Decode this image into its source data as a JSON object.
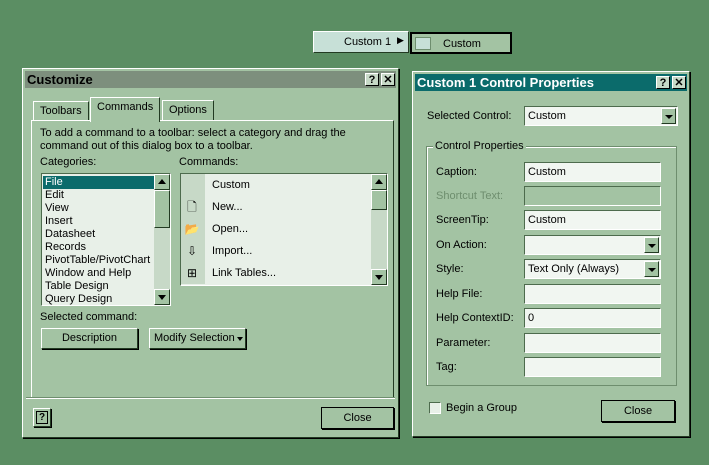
{
  "floating_toolbar": {
    "menu_label": "Custom 1",
    "button_label": "Custom"
  },
  "customize": {
    "title": "Customize",
    "help_btn": "?",
    "close_btn": "✕",
    "tabs": [
      "Toolbars",
      "Commands",
      "Options"
    ],
    "instructions": "To add a command to a toolbar: select a category and drag the command out of this dialog box to a toolbar.",
    "categories_label": "Categories:",
    "commands_label": "Commands:",
    "categories": [
      "File",
      "Edit",
      "View",
      "Insert",
      "Datasheet",
      "Records",
      "PivotTable/PivotChart",
      "Window and Help",
      "Table Design",
      "Query Design"
    ],
    "commands": [
      {
        "label": "Custom",
        "icon": "blank-icon"
      },
      {
        "label": "New...",
        "icon": "new-document-icon"
      },
      {
        "label": "Open...",
        "icon": "open-folder-icon"
      },
      {
        "label": "Import...",
        "icon": "import-icon"
      },
      {
        "label": "Link Tables...",
        "icon": "link-tables-icon"
      }
    ],
    "selected_command_label": "Selected command:",
    "description_btn": "Description",
    "modify_selection_btn": "Modify Selection",
    "close_button": "Close",
    "help_icon_label": "?"
  },
  "props": {
    "title": "Custom 1 Control Properties",
    "help_btn": "?",
    "close_btn": "✕",
    "selected_control_label": "Selected Control:",
    "selected_control_value": "Custom",
    "group_label": "Control Properties",
    "caption_label": "Caption:",
    "caption_value": "Custom",
    "shortcut_label": "Shortcut Text:",
    "shortcut_value": "",
    "screentip_label": "ScreenTip:",
    "screentip_value": "Custom",
    "onaction_label": "On Action:",
    "onaction_value": "",
    "style_label": "Style:",
    "style_value": "Text Only (Always)",
    "helpfile_label": "Help File:",
    "helpfile_value": "",
    "helpcontext_label": "Help ContextID:",
    "helpcontext_value": "0",
    "parameter_label": "Parameter:",
    "parameter_value": "",
    "tag_label": "Tag:",
    "tag_value": "",
    "begin_group_label": "Begin a Group",
    "close_button": "Close"
  },
  "colors": {
    "desktop": "#5b8e63",
    "dialog": "#a3c3a3",
    "title_inactive": "#7d8f7d",
    "title_active": "#0b6b6b",
    "selection": "#0b6b6b"
  }
}
